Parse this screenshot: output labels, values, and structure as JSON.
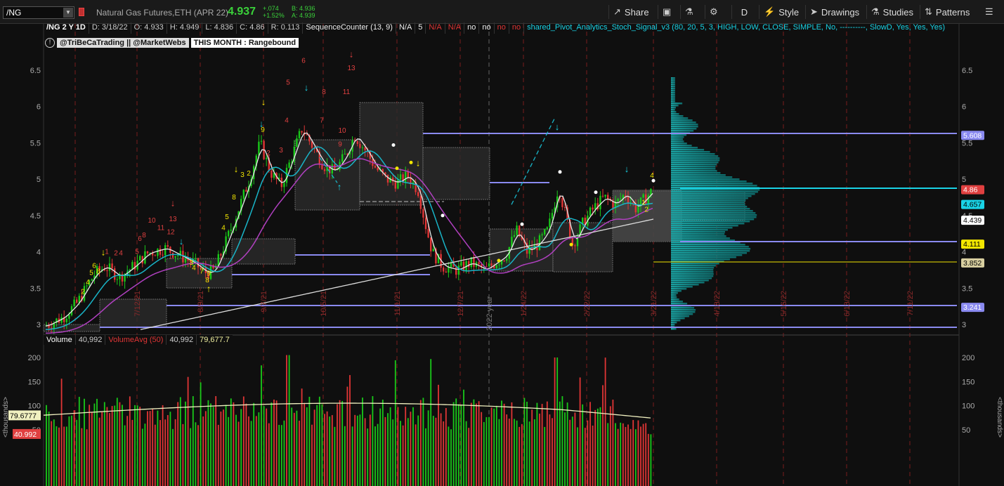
{
  "toolbar": {
    "symbol": "/NG",
    "instrument": "Natural Gas Futures,ETH (APR 22)",
    "last": "4.937",
    "change": "+.074",
    "change_pct": "+1.52%",
    "bid": "B: 4.936",
    "ask": "A: 4.939",
    "share": "Share",
    "period": "D",
    "style": "Style",
    "drawings": "Drawings",
    "studies": "Studies",
    "patterns": "Patterns"
  },
  "header": {
    "symbol_period": "/NG 2 Y 1D",
    "date": "D: 3/18/22",
    "open": "O: 4.933",
    "high": "H: 4.949",
    "low": "L: 4.836",
    "close": "C: 4.86",
    "range": "R: 0.113",
    "study1": "SequenceCounter (13, 9)",
    "s1": "N/A",
    "s2": "5",
    "s3": "N/A",
    "s4": "N/A",
    "s5": "no",
    "s6": "no",
    "s7": "no",
    "s8": "no",
    "study2": "shared_Pivot_Analytics_Stoch_Signal_v3 (80, 20, 5, 3, HIGH, LOW, CLOSE, SIMPLE, No, ----------, SlowD, Yes, Yes, Yes)"
  },
  "tags": {
    "handles": "@TriBeCaTrading || @MarketWebs",
    "month": "THIS MONTH : Rangebound"
  },
  "price_axis": {
    "ticks": [
      "6.5",
      "6",
      "5.5",
      "5",
      "4.5",
      "4",
      "3.5",
      "3"
    ],
    "labels": [
      {
        "value": "5.608",
        "color": "#8a8af0"
      },
      {
        "value": "4.86",
        "color": "#e04040"
      },
      {
        "value": "4.657",
        "color": "#19d3e6"
      },
      {
        "value": "4.439",
        "color": "#ffffff"
      },
      {
        "value": "4.111",
        "color": "#f2e600"
      },
      {
        "value": "3.852",
        "color": "#d8cfa0"
      },
      {
        "value": "3.241",
        "color": "#8a8af0"
      }
    ]
  },
  "date_axis": [
    "7/12/21",
    "8/9/21",
    "9/7/21",
    "10/5/21",
    "11/1/21",
    "12/7/21",
    "2022 year",
    "1/24/22",
    "2/22/22",
    "3/21/22",
    "4/18/22",
    "5/16/22",
    "6/13/22",
    "7/11/22"
  ],
  "volume": {
    "label": "Volume",
    "value": "40,992",
    "avg_label": "VolumeAvg (50)",
    "avg_value": "40,992",
    "avg2": "79,677.7",
    "ticks": [
      "200",
      "150",
      "100",
      "50"
    ],
    "left_avg": "79.6777",
    "left_vol": "40.992",
    "unit": "<thousands>"
  },
  "colors": {
    "up": "#19c819",
    "down": "#e03535",
    "bg": "#0f0f0f"
  }
}
